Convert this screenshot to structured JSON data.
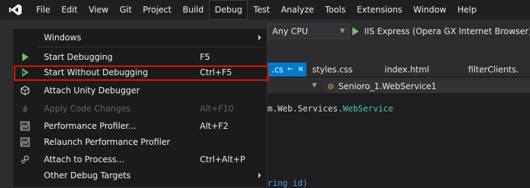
{
  "menubar": {
    "items": [
      "File",
      "Edit",
      "View",
      "Git",
      "Project",
      "Build",
      "Debug",
      "Test",
      "Analyze",
      "Tools",
      "Extensions",
      "Window",
      "Help"
    ],
    "open_index": 6
  },
  "toolbar": {
    "platform": "Any CPU",
    "run_label": "IIS Express (Opera GX Internet Browser)"
  },
  "tabs": [
    {
      "label": ".cs",
      "active": true,
      "pin": "←",
      "close": "✕"
    },
    {
      "label": "styles.css",
      "active": false
    },
    {
      "label": "index.html",
      "active": false
    },
    {
      "label": "filterClients.",
      "active": false
    }
  ],
  "nav": {
    "member": "Senioro_1.WebService1"
  },
  "code": {
    "line1_ns": "m.Web.Services.",
    "line1_type": "WebService",
    "line2": "ring id)"
  },
  "debug_menu": {
    "items": [
      {
        "label": "Windows",
        "shortcut": "",
        "icon": "none",
        "submenu": true,
        "disabled": false
      },
      {
        "label": "Start Debugging",
        "shortcut": "F5",
        "icon": "play-icon",
        "submenu": false,
        "disabled": false
      },
      {
        "label": "Start Without Debugging",
        "shortcut": "Ctrl+F5",
        "icon": "play-outline-icon",
        "submenu": false,
        "disabled": false
      },
      {
        "label": "Attach Unity Debugger",
        "shortcut": "",
        "icon": "unity-icon",
        "submenu": false,
        "disabled": false
      },
      {
        "label": "Apply Code Changes",
        "shortcut": "Alt+F10",
        "icon": "flame-icon",
        "submenu": false,
        "disabled": true
      },
      {
        "label": "Performance Profiler...",
        "shortcut": "Alt+F2",
        "icon": "profiler-icon",
        "submenu": false,
        "disabled": false
      },
      {
        "label": "Relaunch Performance Profiler",
        "shortcut": "",
        "icon": "profiler-icon",
        "submenu": false,
        "disabled": false
      },
      {
        "label": "Attach to Process...",
        "shortcut": "Ctrl+Alt+P",
        "icon": "attach-process-icon",
        "submenu": false,
        "disabled": false
      },
      {
        "label": "Other Debug Targets",
        "shortcut": "",
        "icon": "none",
        "submenu": true,
        "disabled": false
      }
    ],
    "highlighted_index": 2
  },
  "colors": {
    "highlight_border": "#e51400",
    "accent": "#007acc",
    "play_green": "#6cc26c"
  }
}
